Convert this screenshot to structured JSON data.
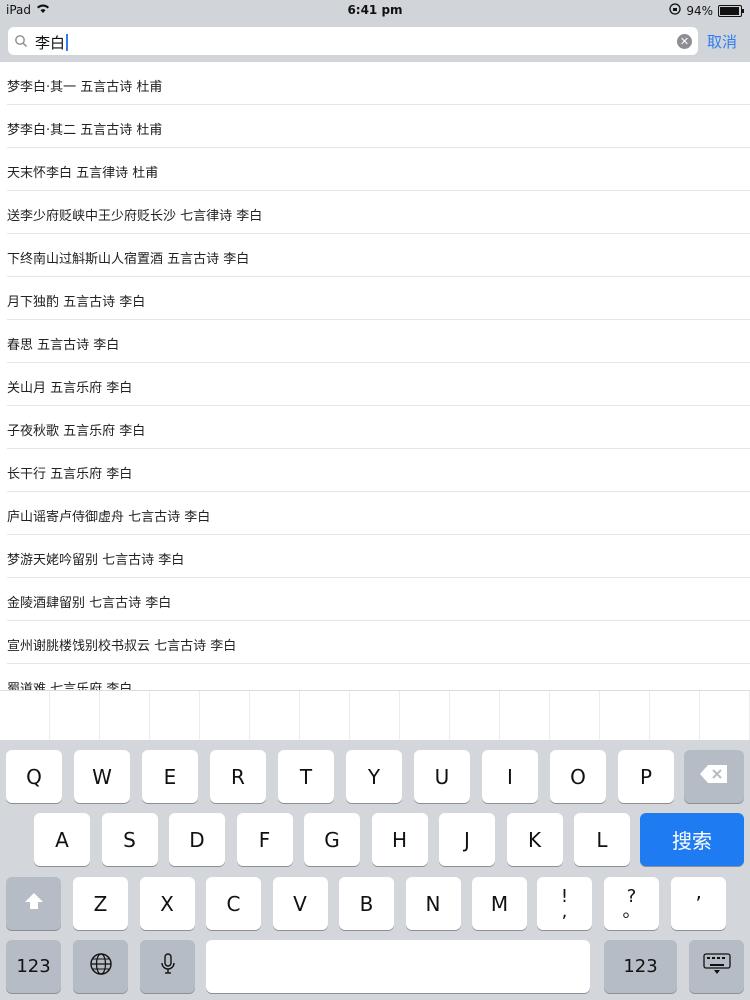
{
  "status": {
    "device": "iPad",
    "time": "6:41 pm",
    "battery": "94%",
    "battery_level": 0.94
  },
  "search": {
    "value": "李白",
    "cancel_label": "取消",
    "clear_icon": "clear-icon"
  },
  "results": [
    "梦李白·其一 五言古诗 杜甫",
    "梦李白·其二 五言古诗 杜甫",
    "天末怀李白 五言律诗 杜甫",
    "送李少府贬峡中王少府贬长沙 七言律诗 李白",
    "下终南山过斛斯山人宿置酒 五言古诗 李白",
    "月下独酌 五言古诗 李白",
    "春思 五言古诗 李白",
    "关山月 五言乐府 李白",
    "子夜秋歌 五言乐府 李白",
    "长干行 五言乐府 李白",
    "庐山谣寄卢侍御虚舟 七言古诗 李白",
    "梦游天姥吟留别 七言古诗 李白",
    "金陵酒肆留别 七言古诗 李白",
    "宣州谢朓楼饯别校书叔云 七言古诗 李白",
    "蜀道难 七言乐府 李白"
  ],
  "keyboard": {
    "row1": [
      "Q",
      "W",
      "E",
      "R",
      "T",
      "Y",
      "U",
      "I",
      "O",
      "P"
    ],
    "row2": [
      "A",
      "S",
      "D",
      "F",
      "G",
      "H",
      "J",
      "K",
      "L"
    ],
    "row3": [
      "Z",
      "X",
      "C",
      "V",
      "B",
      "N",
      "M"
    ],
    "search_label": "搜索",
    "numbers_label": "123",
    "punct1_top": "!",
    "punct1_bottom": ",",
    "punct2_top": "?",
    "punct2_bottom": "。",
    "punct3": "’"
  }
}
